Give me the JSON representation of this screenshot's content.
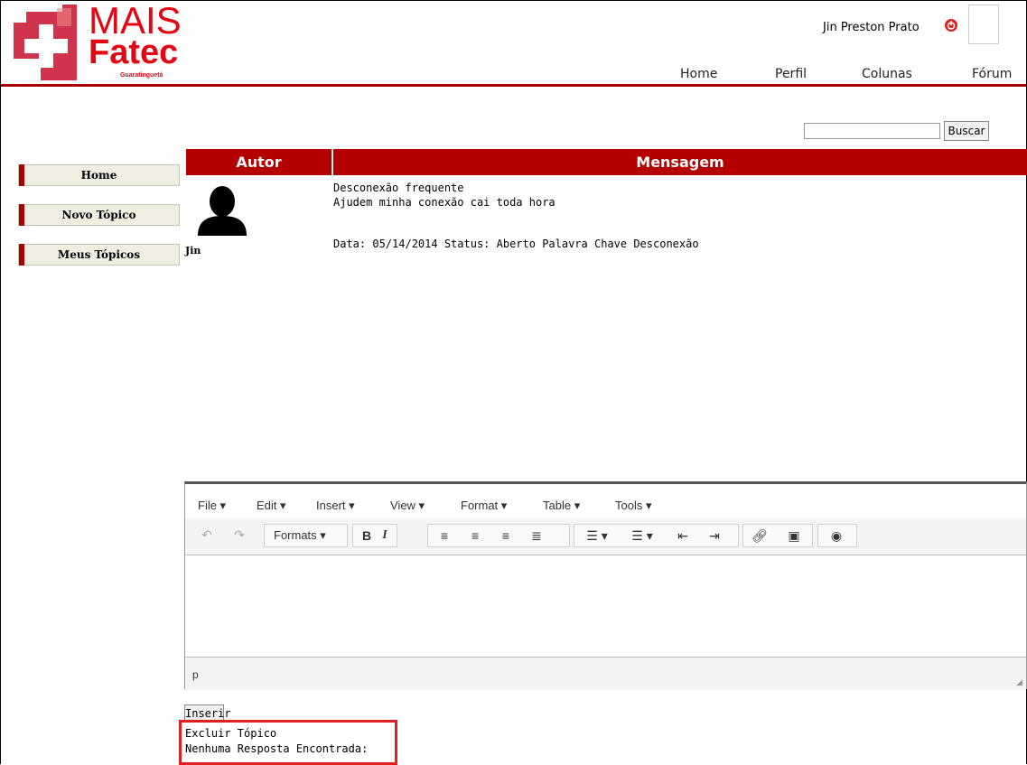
{
  "logo": {
    "line1": "MAIS",
    "line2": "Fatec",
    "sub": "Guaratinguetá"
  },
  "user": {
    "name": "Jin Preston Prato"
  },
  "nav": [
    "Home",
    "Perfil",
    "Colunas",
    "Fórum"
  ],
  "search": {
    "button": "Buscar",
    "value": ""
  },
  "sidebar": [
    "Home",
    "Novo Tópico",
    "Meus Tópicos"
  ],
  "table": {
    "headers": [
      "Autor",
      "Mensagem"
    ],
    "author": "Jin",
    "title": "Desconexão frequente",
    "body": "Ajudem minha conexão cai toda hora",
    "meta": "Data: 05/14/2014 Status: Aberto Palavra Chave Desconexão"
  },
  "editor": {
    "menus": [
      "File ▾",
      "Edit ▾",
      "Insert ▾",
      "View ▾",
      "Format ▾",
      "Table ▾",
      "Tools ▾"
    ],
    "formats": "Formats ▾",
    "path": "p"
  },
  "actions": {
    "insert": "Inserir",
    "delete": "Excluir Tópico",
    "no_reply": "Nenhuma Resposta Encontrada:"
  },
  "colors": {
    "brand": "#b30000",
    "highlight": "#e02020"
  }
}
